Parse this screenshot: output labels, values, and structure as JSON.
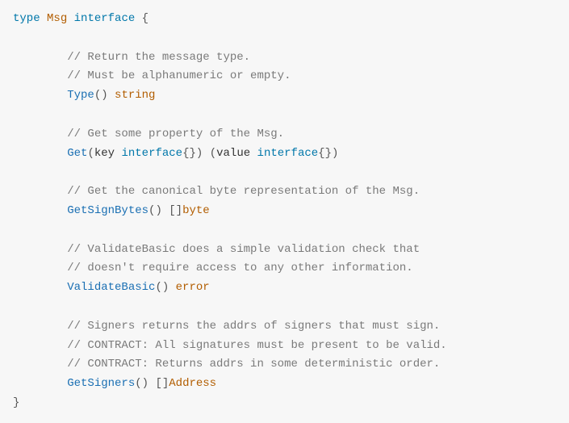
{
  "code": {
    "line1": {
      "kw_type": "type",
      "name": "Msg",
      "kw_interface": "interface",
      "brace_open": "{"
    },
    "comment_type1": "// Return the message type.",
    "comment_type2": "// Must be alphanumeric or empty.",
    "method_type": "Type",
    "ret_string": "string",
    "comment_get": "// Get some property of the Msg.",
    "method_get": "Get",
    "param_key": "key",
    "kw_interface2": "interface",
    "param_value": "value",
    "kw_interface3": "interface",
    "comment_getsign": "// Get the canonical byte representation of the Msg.",
    "method_getsign": "GetSignBytes",
    "ret_byte": "byte",
    "comment_vb1": "// ValidateBasic does a simple validation check that",
    "comment_vb2": "// doesn't require access to any other information.",
    "method_vb": "ValidateBasic",
    "ret_error": "error",
    "comment_sign1": "// Signers returns the addrs of signers that must sign.",
    "comment_sign2": "// CONTRACT: All signatures must be present to be valid.",
    "comment_sign3": "// CONTRACT: Returns addrs in some deterministic order.",
    "method_getsigners": "GetSigners",
    "ret_address": "Address",
    "brace_close": "}"
  }
}
